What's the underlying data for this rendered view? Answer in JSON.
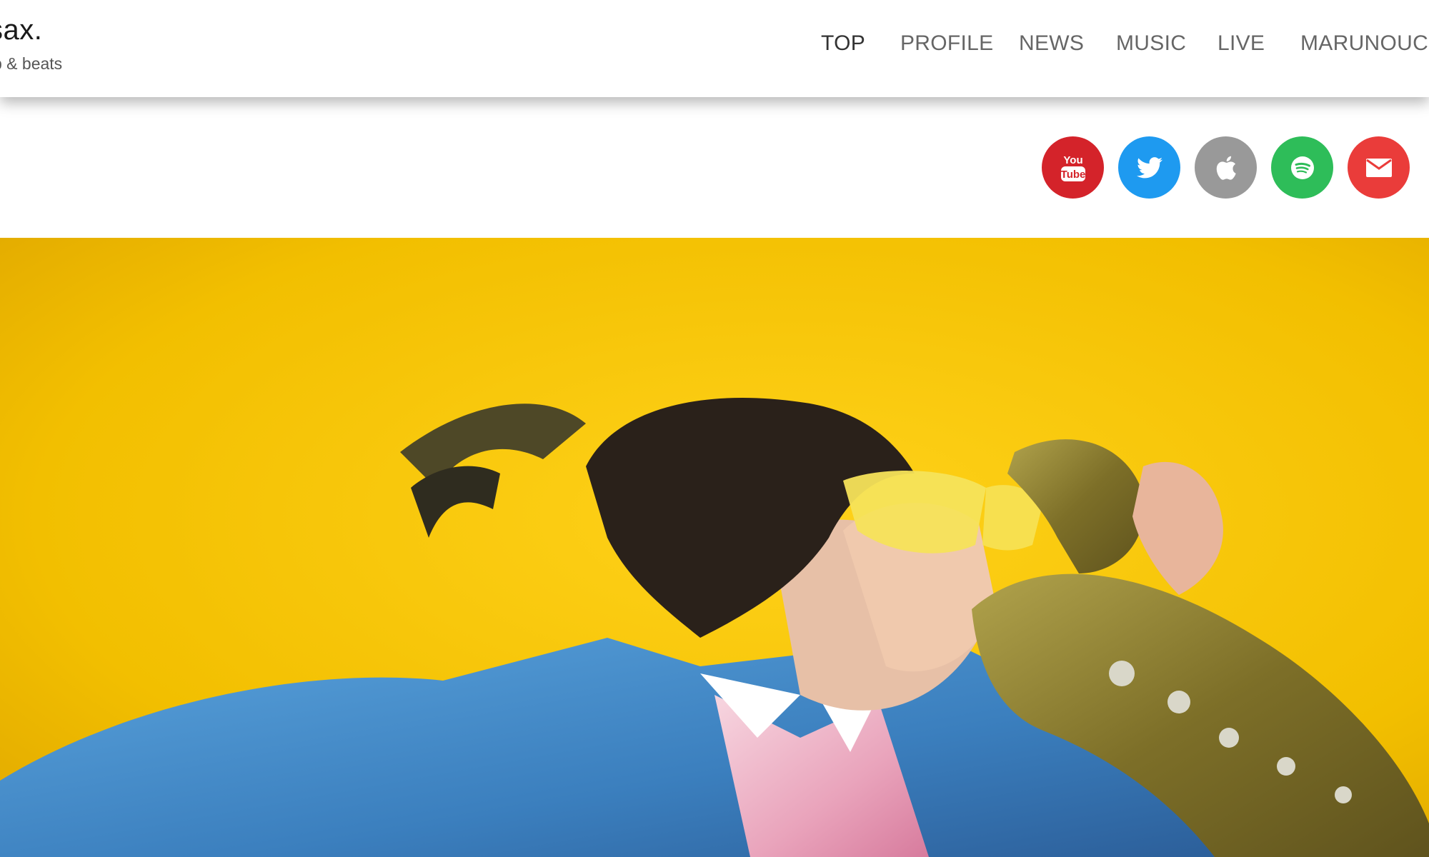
{
  "brand": {
    "title": "sax.",
    "subtitle": "p & beats"
  },
  "nav": {
    "items": [
      {
        "label": "TOP",
        "active": true
      },
      {
        "label": "PROFILE"
      },
      {
        "label": "NEWS"
      },
      {
        "label": "MUSIC"
      },
      {
        "label": "LIVE"
      },
      {
        "label": "MARUNOUCHI"
      }
    ]
  },
  "social": [
    {
      "name": "youtube-icon",
      "color": "#d4232a",
      "glyph_top": "You",
      "glyph_bottom": "Tube"
    },
    {
      "name": "twitter-icon",
      "color": "#1e9af0"
    },
    {
      "name": "apple-icon",
      "color": "#999999"
    },
    {
      "name": "spotify-icon",
      "color": "#2ebd59"
    },
    {
      "name": "mail-icon",
      "color": "#ea3c3a"
    }
  ],
  "hero": {
    "alt": "Saxophonist with yellow sunglasses and blue jacket holding a saxophone against a yellow background",
    "background_color": "#f3c300",
    "jacket_color": "#3f86c4",
    "sax_color": "#8c7f2f"
  }
}
